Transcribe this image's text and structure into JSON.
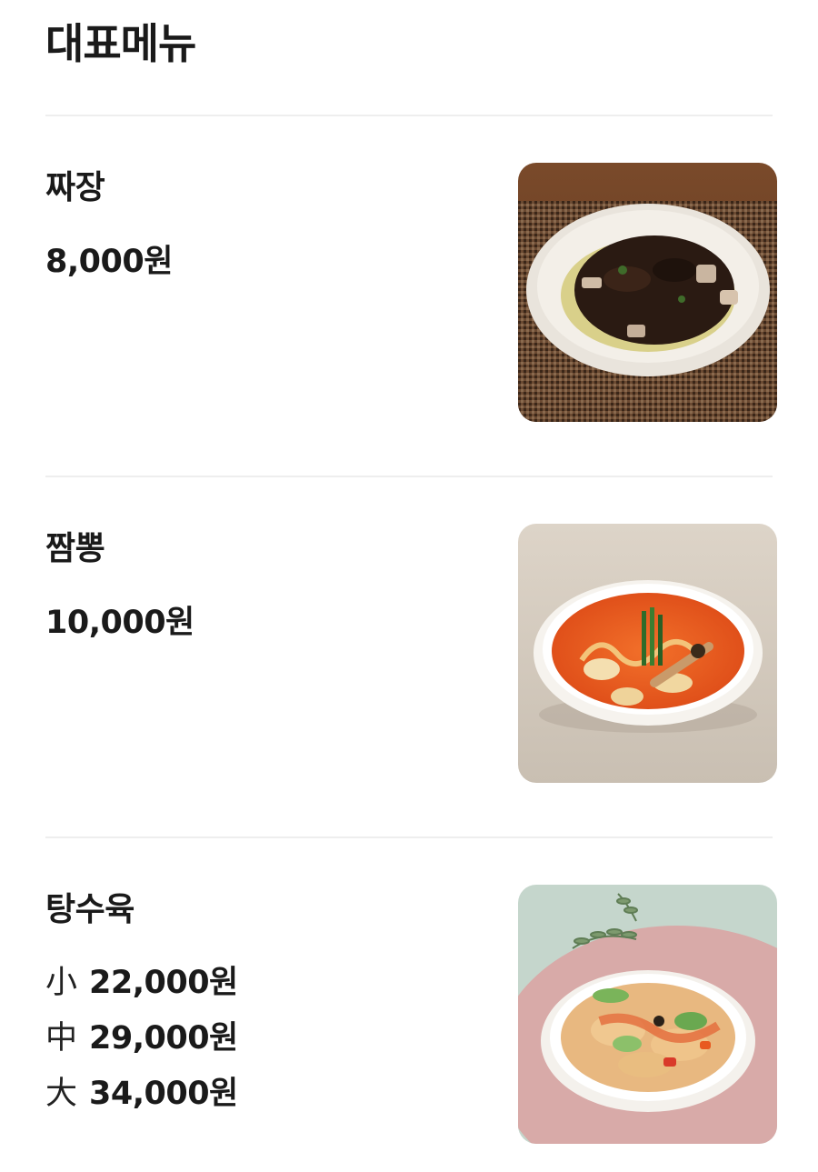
{
  "section": {
    "title": "대표메뉴"
  },
  "menu": [
    {
      "name": "짜장",
      "price": "8,000원",
      "image": "jajangmyeon-photo"
    },
    {
      "name": "짬뽕",
      "price": "10,000원",
      "image": "jjamppong-photo"
    },
    {
      "name": "탕수육",
      "image": "tangsuyuk-photo",
      "sizes": [
        {
          "label": "小",
          "price": "22,000원"
        },
        {
          "label": "中",
          "price": "29,000원"
        },
        {
          "label": "大",
          "price": "34,000원"
        }
      ]
    }
  ]
}
